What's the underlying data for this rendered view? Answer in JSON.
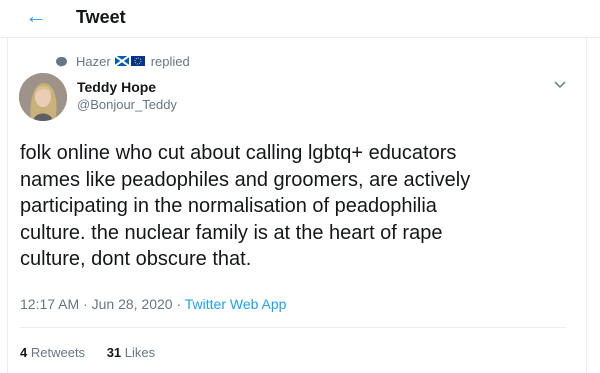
{
  "header": {
    "back_icon": "arrow-left-icon",
    "title": "Tweet",
    "accent": "#1da1f2"
  },
  "reply_context": {
    "icon": "reply-bubble-icon",
    "name": "Hazer",
    "flags": [
      "scotland-flag-icon",
      "eu-flag-icon"
    ],
    "label": "replied"
  },
  "author": {
    "name": "Teddy Hope",
    "handle": "@Bonjour_Teddy",
    "avatar_icon": "profile-photo"
  },
  "tweet": {
    "lines": [
      "folk online who cut about calling lgbtq+ educators",
      "names like peadophiles and groomers, are actively",
      "participating in the normalisation of peadophilia",
      "culture.  the nuclear family is at the heart of rape",
      "culture, dont obscure that."
    ]
  },
  "meta": {
    "time": "12:17 AM",
    "sep1": " · ",
    "date": "Jun 28, 2020",
    "sep2": " · ",
    "app": "Twitter Web App"
  },
  "stats": {
    "retweets_count": "4",
    "retweets_label": "Retweets",
    "likes_count": "31",
    "likes_label": "Likes"
  }
}
